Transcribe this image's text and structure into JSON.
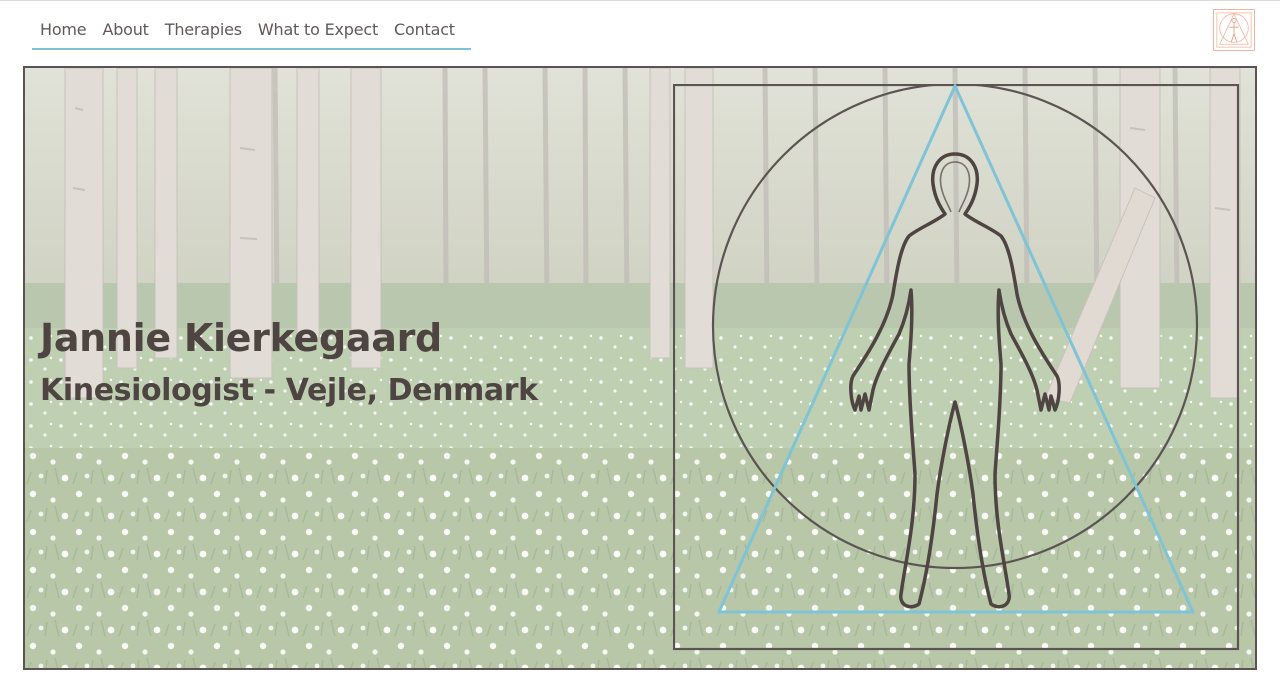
{
  "nav": {
    "items": [
      {
        "label": "Home"
      },
      {
        "label": "About"
      },
      {
        "label": "Therapies"
      },
      {
        "label": "What to Expect"
      },
      {
        "label": "Contact"
      }
    ]
  },
  "hero": {
    "name": "Jannie Kierkegaard",
    "subtitle": "Kinesiologist - Vejle, Denmark"
  },
  "colors": {
    "text": "#4e4442",
    "nav_text": "#5f5a58",
    "accent": "#7fc4d6",
    "frame": "#5b5452",
    "logo_accent": "#f2b49c"
  },
  "icons": {
    "logo": "vitruvian-figure-logo",
    "emblem": "human-figure-triangle-circle-emblem"
  }
}
